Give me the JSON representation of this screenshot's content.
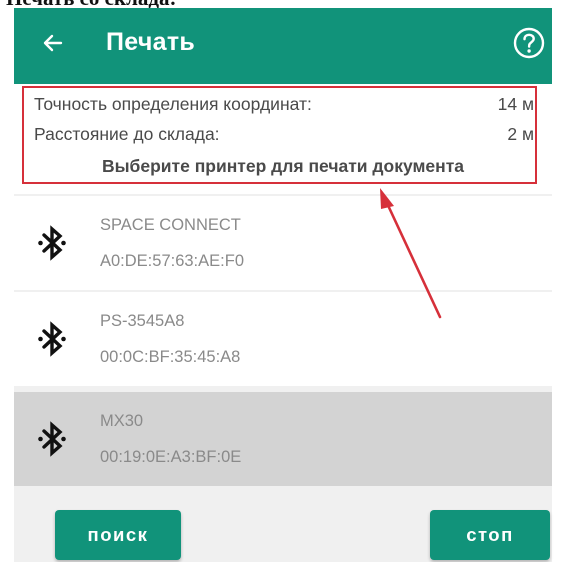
{
  "page_caption_fragment": "Печать со склада:",
  "app_bar": {
    "title": "Печать",
    "back_icon": "arrow-left-icon",
    "help_icon": "question-circle-icon",
    "color": "#11937a"
  },
  "info": {
    "accuracy_label": "Точность определения координат:",
    "accuracy_value": "14 м",
    "distance_label": "Расстояние до склада:",
    "distance_value": "2 м",
    "hint": "Выберите принтер для печати документа"
  },
  "devices": [
    {
      "name": "SPACE CONNECT",
      "mac": "A0:DE:57:63:AE:F0",
      "icon": "bluetooth-icon",
      "selected": false
    },
    {
      "name": "PS-3545A8",
      "mac": "00:0C:BF:35:45:A8",
      "icon": "bluetooth-icon",
      "selected": false
    },
    {
      "name": "MX30",
      "mac": "00:19:0E:A3:BF:0E",
      "icon": "bluetooth-icon",
      "selected": true
    }
  ],
  "buttons": {
    "search_label": "поиск",
    "stop_label": "стоп"
  },
  "annotation": {
    "highlight_color": "#d6303a"
  }
}
